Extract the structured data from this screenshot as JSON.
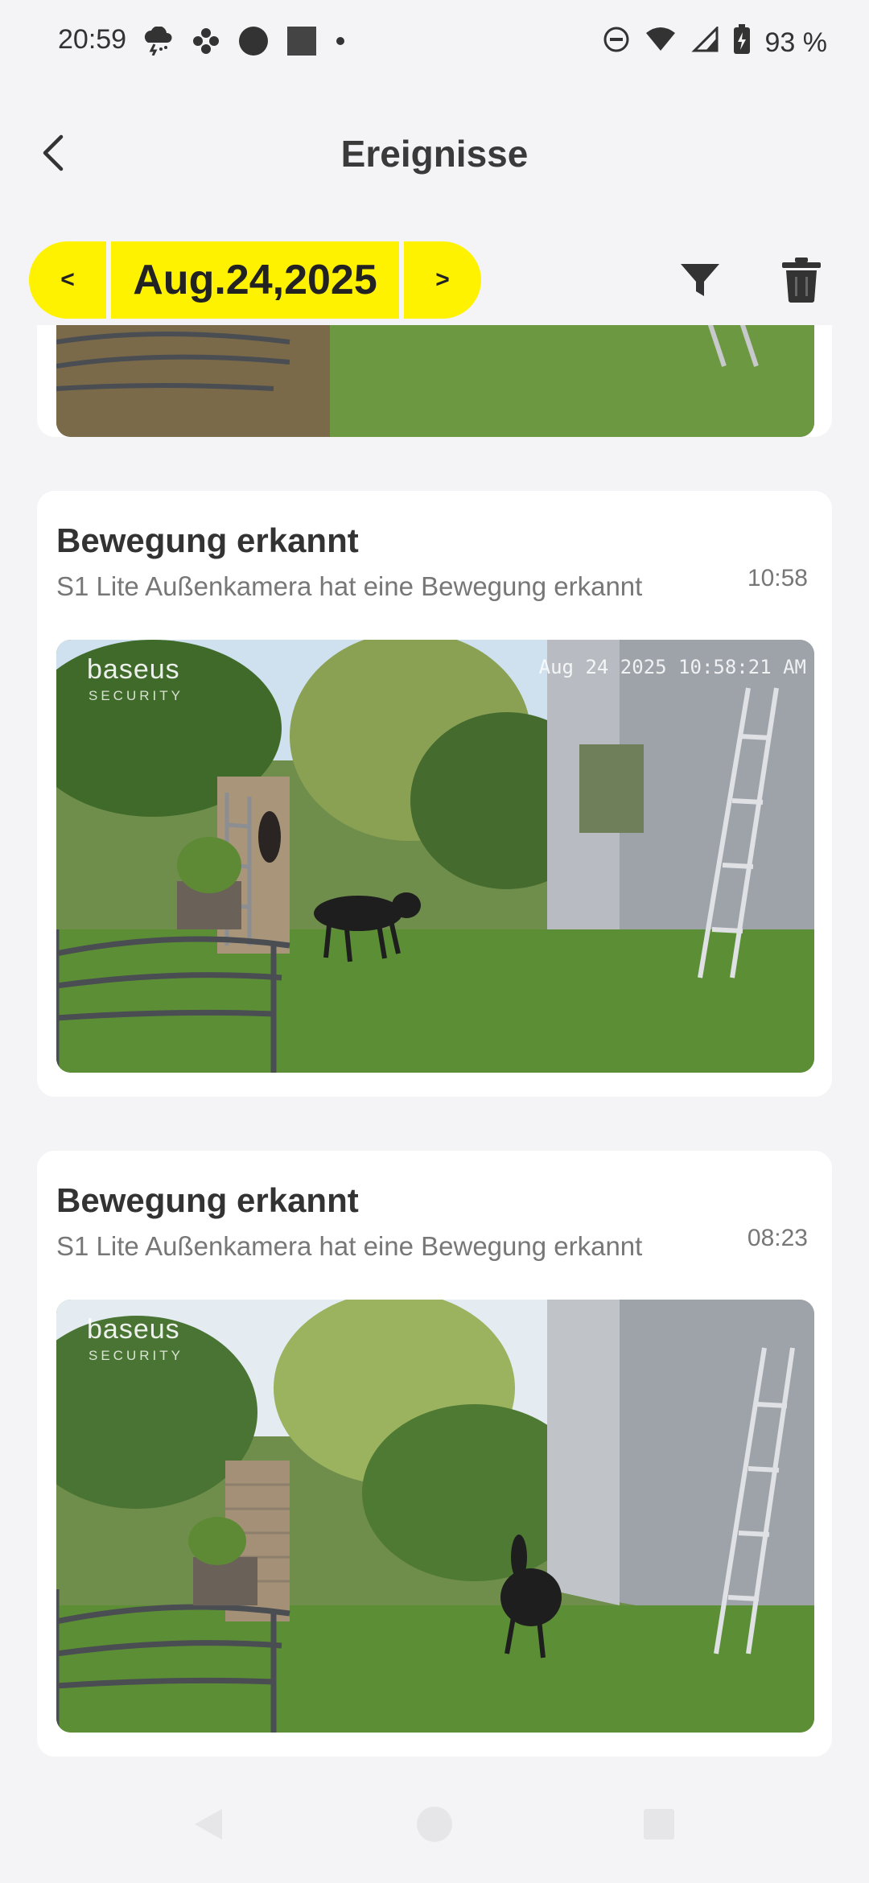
{
  "status_bar": {
    "time": "20:59",
    "battery": "93 %",
    "icons_left": [
      "thunderstorm-icon",
      "pinwheel-icon",
      "circle-app-icon",
      "square-app-icon",
      "dot-icon"
    ],
    "icons_right": [
      "do-not-disturb-icon",
      "wifi-icon",
      "cellular-icon",
      "battery-charging-icon"
    ]
  },
  "header": {
    "title": "Ereignisse",
    "back_icon": "chevron-left-icon"
  },
  "date_nav": {
    "prev_label": "<",
    "date": "Aug.24,2025",
    "next_label": ">",
    "accent_color": "#fff200",
    "filter_icon": "filter-icon",
    "delete_icon": "trash-icon"
  },
  "events": [
    {
      "title": "Bewegung erkannt",
      "description": "S1 Lite Außenkamera hat eine Bewegung erkannt",
      "time": "10:58",
      "watermark_brand": "baseus",
      "watermark_sub": "SECURITY",
      "timestamp_overlay": "Aug 24 2025  10:58:21 AM"
    },
    {
      "title": "Bewegung erkannt",
      "description": "S1 Lite Außenkamera hat eine Bewegung erkannt",
      "time": "08:23",
      "watermark_brand": "baseus",
      "watermark_sub": "SECURITY",
      "timestamp_overlay": ""
    }
  ],
  "nav_bar": {
    "icons": [
      "back-triangle-icon",
      "home-circle-icon",
      "recents-square-icon"
    ]
  }
}
